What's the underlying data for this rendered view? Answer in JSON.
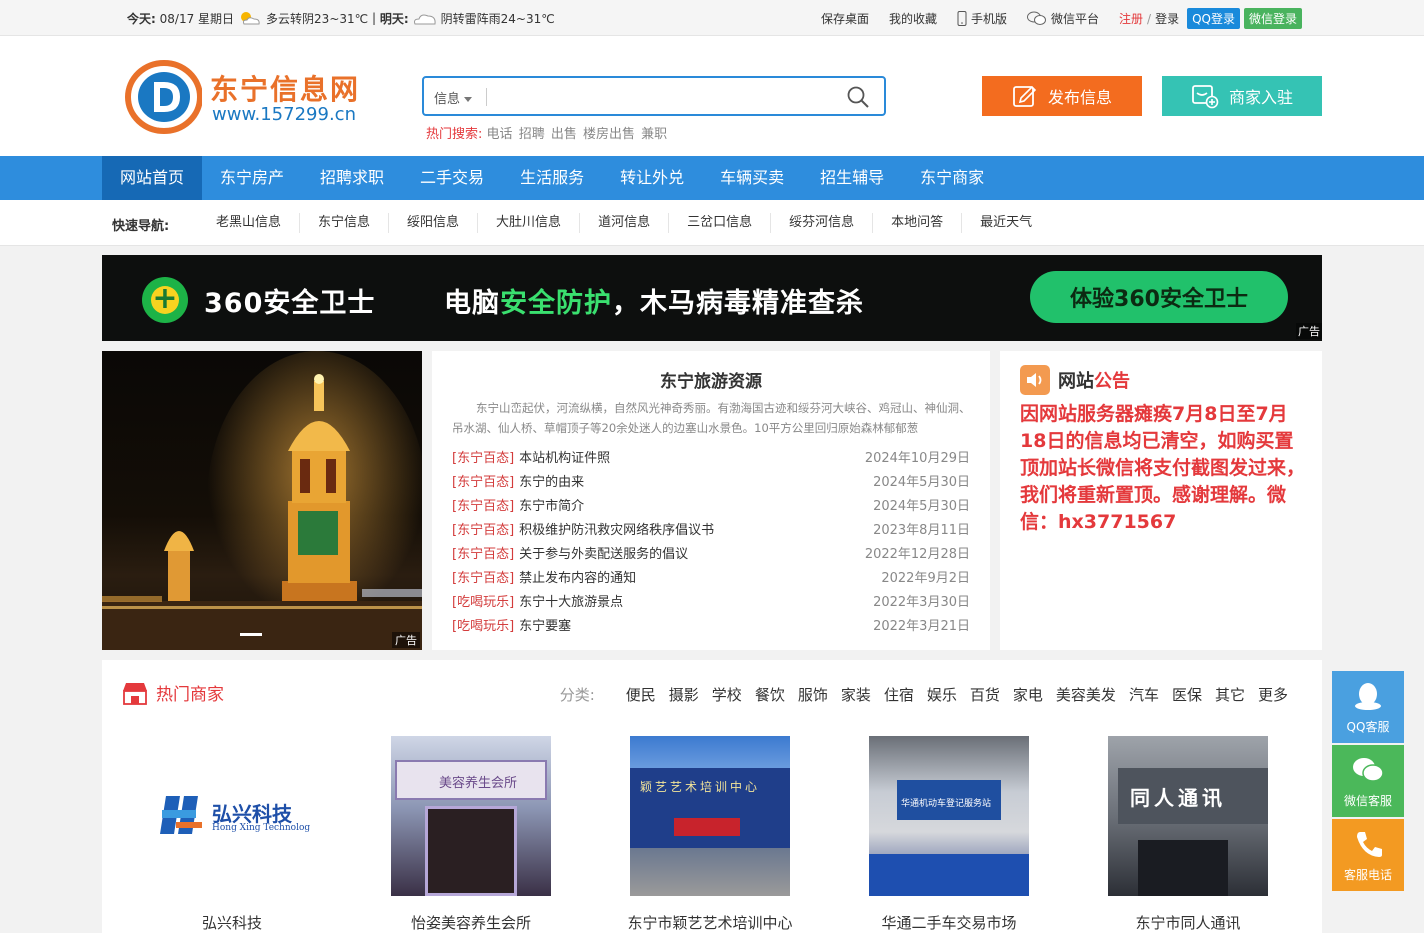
{
  "topbar": {
    "today_label": "今天:",
    "today_date": "08/17 星期日",
    "today_weather": "多云转阴23~31℃",
    "separator": "|",
    "tomorrow_label": "明天:",
    "tomorrow_weather": "阴转雷阵雨24~31℃",
    "links": [
      "保存桌面",
      "我的收藏",
      "手机版",
      "微信平台"
    ],
    "register": "注册",
    "slash": "/",
    "login": "登录",
    "qq_login": "QQ登录",
    "wx_login": "微信登录"
  },
  "header": {
    "site_title": "东宁信息网",
    "site_url": "www.157299.cn",
    "search_category": "信息",
    "search_value": "",
    "hot_label": "热门搜索:",
    "hot_keywords": [
      "电话",
      "招聘",
      "出售",
      "楼房出售",
      "兼职"
    ],
    "publish_label": "发布信息",
    "merchant_label": "商家入驻"
  },
  "mainnav": [
    "网站首页",
    "东宁房产",
    "招聘求职",
    "二手交易",
    "生活服务",
    "转让外兑",
    "车辆买卖",
    "招生辅导",
    "东宁商家"
  ],
  "quicknav": {
    "label": "快速导航:",
    "items": [
      "老黑山信息",
      "东宁信息",
      "绥阳信息",
      "大肚川信息",
      "道河信息",
      "三岔口信息",
      "绥芬河信息",
      "本地问答",
      "最近天气"
    ]
  },
  "banner": {
    "brand": "360安全卫士",
    "slogan_a": "电脑",
    "slogan_hl": "安全防护",
    "slogan_b": "，木马病毒精准查杀",
    "cta": "体验360安全卫士",
    "ad": "广告"
  },
  "photo": {
    "ad": "广告"
  },
  "travel": {
    "title": "东宁旅游资源",
    "intro": "东宁山峦起伏，河流纵横，自然风光神奇秀丽。有渤海国古迹和绥芬河大峡谷、鸡冠山、神仙洞、吊水湖、仙人桥、草帽顶子等20余处迷人的边塞山水景色。10平方公里回归原始森林郁郁葱",
    "items": [
      {
        "cat": "[东宁百态]",
        "title": "本站机构证件照",
        "date": "2024年10月29日"
      },
      {
        "cat": "[东宁百态]",
        "title": "东宁的由来",
        "date": "2024年5月30日"
      },
      {
        "cat": "[东宁百态]",
        "title": "东宁市简介",
        "date": "2024年5月30日"
      },
      {
        "cat": "[东宁百态]",
        "title": "积极维护防汛救灾网络秩序倡议书",
        "date": "2023年8月11日"
      },
      {
        "cat": "[东宁百态]",
        "title": "关于参与外卖配送服务的倡议",
        "date": "2022年12月28日"
      },
      {
        "cat": "[东宁百态]",
        "title": "禁止发布内容的通知",
        "date": "2022年9月2日"
      },
      {
        "cat": "[吃喝玩乐]",
        "title": "东宁十大旅游景点",
        "date": "2022年3月30日"
      },
      {
        "cat": "[吃喝玩乐]",
        "title": "东宁要塞",
        "date": "2022年3月21日"
      }
    ]
  },
  "notice": {
    "title_a": "网站",
    "title_b": "公告",
    "body": "因网站服务器瘫痪7月8日至7月18日的信息均已清空，如购买置顶加站长微信将支付截图发过来，我们将重新置顶。感谢理解。微信：hx3771567"
  },
  "shops": {
    "title": "热门商家",
    "cats_label": "分类:",
    "cats": [
      "便民",
      "摄影",
      "学校",
      "餐饮",
      "服饰",
      "家装",
      "住宿",
      "娱乐",
      "百货",
      "家电",
      "美容美发",
      "汽车",
      "医保",
      "其它",
      "更多"
    ],
    "items": [
      {
        "name": "弘兴科技",
        "logo_text": "弘兴科技",
        "logo_sub": "Hong Xing Technolog"
      },
      {
        "name": "怡姿美容养生会所",
        "sign": "美容养生会所"
      },
      {
        "name": "东宁市颖艺艺术培训中心",
        "sign": "颖艺艺术培训中心"
      },
      {
        "name": "华通二手车交易市场",
        "sign": "华通机动车登记服务站"
      },
      {
        "name": "东宁市同人通讯",
        "sign": "同人通讯"
      }
    ]
  },
  "side": {
    "qq": "QQ客服",
    "wx": "微信客服",
    "tel": "客服电话"
  }
}
